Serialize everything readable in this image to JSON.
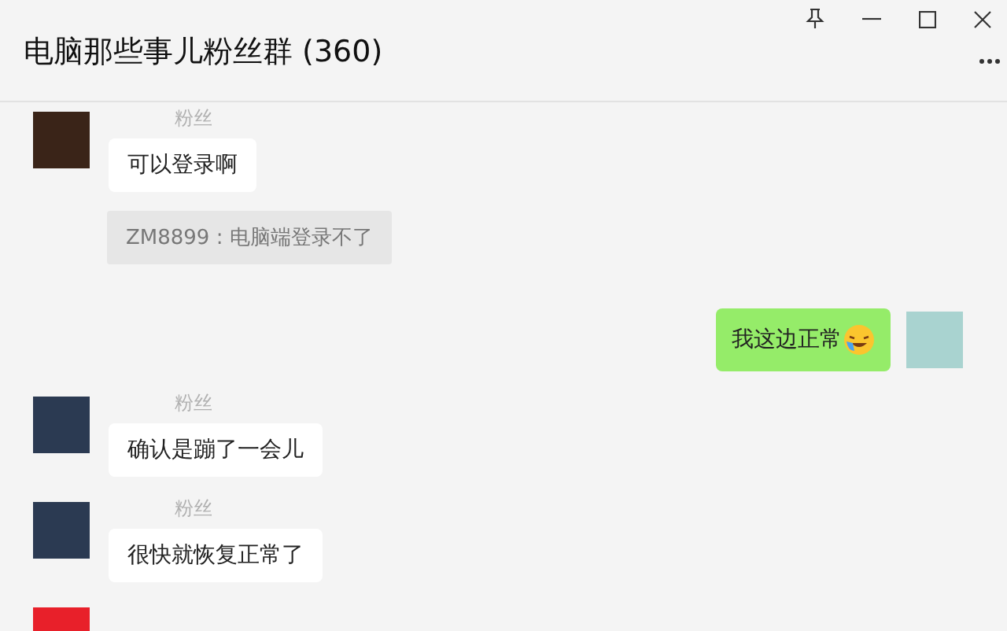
{
  "window": {
    "title": "电脑那些事儿粉丝群 (360)"
  },
  "messages": [
    {
      "kind": "incoming",
      "sender": "粉丝",
      "text": "可以登录啊",
      "color": "#3a2418"
    },
    {
      "kind": "quote",
      "text": "ZM8899 : 电脑端登录不了"
    },
    {
      "kind": "outgoing",
      "text": "我这边正常",
      "color": "#a9d3d0"
    },
    {
      "kind": "incoming",
      "sender": "粉丝",
      "text": "确认是蹦了一会儿",
      "color": "#2b3a52"
    },
    {
      "kind": "incoming",
      "sender": "粉丝",
      "text": "很快就恢复正常了",
      "color": "#2b3a52"
    },
    {
      "kind": "partial",
      "color": "#e8202a"
    }
  ]
}
